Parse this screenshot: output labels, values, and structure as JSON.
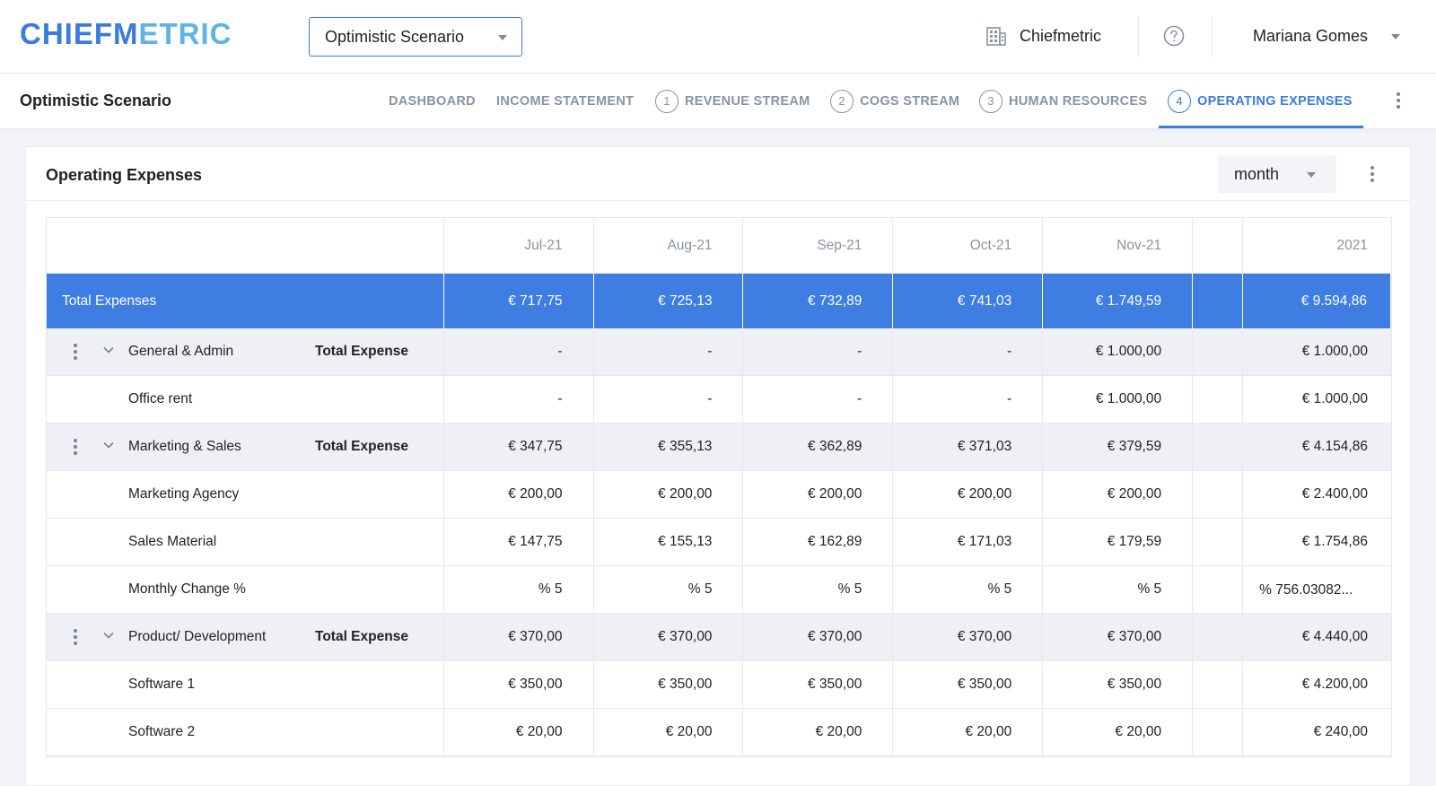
{
  "header": {
    "logo_part1": "CHIEFM",
    "logo_part2": "ETRIC",
    "scenario_select": "Optimistic Scenario",
    "company": "Chiefmetric",
    "user": "Mariana Gomes"
  },
  "subnav": {
    "title": "Optimistic Scenario",
    "tabs": [
      {
        "label": "DASHBOARD",
        "num": ""
      },
      {
        "label": "INCOME STATEMENT",
        "num": ""
      },
      {
        "label": "REVENUE STREAM",
        "num": "1"
      },
      {
        "label": "COGS STREAM",
        "num": "2"
      },
      {
        "label": "HUMAN RESOURCES",
        "num": "3"
      },
      {
        "label": "OPERATING EXPENSES",
        "num": "4"
      }
    ],
    "active_tab": "OPERATING EXPENSES"
  },
  "card": {
    "title": "Operating Expenses",
    "period": "month"
  },
  "table": {
    "columns": [
      "Jul-21",
      "Aug-21",
      "Sep-21",
      "Oct-21",
      "Nov-21",
      "",
      "2021"
    ],
    "total": {
      "label": "Total Expenses",
      "values": [
        "€ 717,75",
        "€ 725,13",
        "€ 732,89",
        "€ 741,03",
        "€ 1.749,59",
        "",
        "€ 9.594,86"
      ]
    },
    "rows": [
      {
        "type": "group",
        "label": "General & Admin",
        "sub": "Total Expense",
        "values": [
          "-",
          "-",
          "-",
          "-",
          "€ 1.000,00",
          "",
          "€ 1.000,00"
        ]
      },
      {
        "type": "item",
        "label": "Office rent",
        "sub": "",
        "values": [
          "-",
          "-",
          "-",
          "-",
          "€ 1.000,00",
          "",
          "€ 1.000,00"
        ]
      },
      {
        "type": "group",
        "label": "Marketing & Sales",
        "sub": "Total Expense",
        "values": [
          "€ 347,75",
          "€ 355,13",
          "€ 362,89",
          "€ 371,03",
          "€ 379,59",
          "",
          "€ 4.154,86"
        ]
      },
      {
        "type": "item",
        "label": "Marketing Agency",
        "sub": "",
        "values": [
          "€ 200,00",
          "€ 200,00",
          "€ 200,00",
          "€ 200,00",
          "€ 200,00",
          "",
          "€ 2.400,00"
        ]
      },
      {
        "type": "item",
        "label": "Sales Material",
        "sub": "",
        "values": [
          "€ 147,75",
          "€ 155,13",
          "€ 162,89",
          "€ 171,03",
          "€ 179,59",
          "",
          "€ 1.754,86"
        ]
      },
      {
        "type": "item",
        "label": "Monthly Change %",
        "sub": "",
        "values": [
          "% 5",
          "% 5",
          "% 5",
          "% 5",
          "% 5",
          "",
          "% 756.03082..."
        ]
      },
      {
        "type": "group",
        "label": "Product/ Development",
        "sub": "Total Expense",
        "values": [
          "€ 370,00",
          "€ 370,00",
          "€ 370,00",
          "€ 370,00",
          "€ 370,00",
          "",
          "€ 4.440,00"
        ]
      },
      {
        "type": "item",
        "label": "Software 1",
        "sub": "",
        "values": [
          "€ 350,00",
          "€ 350,00",
          "€ 350,00",
          "€ 350,00",
          "€ 350,00",
          "",
          "€ 4.200,00"
        ]
      },
      {
        "type": "item",
        "label": "Software 2",
        "sub": "",
        "values": [
          "€ 20,00",
          "€ 20,00",
          "€ 20,00",
          "€ 20,00",
          "€ 20,00",
          "",
          "€ 240,00"
        ]
      }
    ]
  },
  "colors": {
    "accent": "#3a7be0",
    "total_row": "#3e7ee2",
    "group_row": "#eef0f6",
    "muted_text": "#8a93a3"
  }
}
